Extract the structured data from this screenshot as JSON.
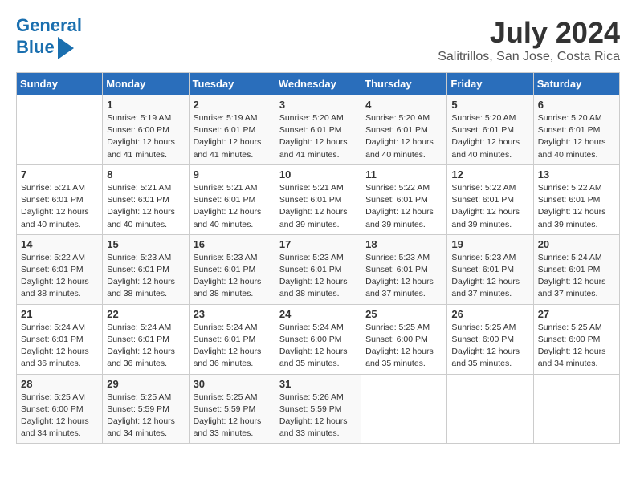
{
  "header": {
    "logo_line1": "General",
    "logo_line2": "Blue",
    "month_year": "July 2024",
    "location": "Salitrillos, San Jose, Costa Rica"
  },
  "days_of_week": [
    "Sunday",
    "Monday",
    "Tuesday",
    "Wednesday",
    "Thursday",
    "Friday",
    "Saturday"
  ],
  "weeks": [
    [
      {
        "day": "",
        "info": ""
      },
      {
        "day": "1",
        "info": "Sunrise: 5:19 AM\nSunset: 6:00 PM\nDaylight: 12 hours\nand 41 minutes."
      },
      {
        "day": "2",
        "info": "Sunrise: 5:19 AM\nSunset: 6:01 PM\nDaylight: 12 hours\nand 41 minutes."
      },
      {
        "day": "3",
        "info": "Sunrise: 5:20 AM\nSunset: 6:01 PM\nDaylight: 12 hours\nand 41 minutes."
      },
      {
        "day": "4",
        "info": "Sunrise: 5:20 AM\nSunset: 6:01 PM\nDaylight: 12 hours\nand 40 minutes."
      },
      {
        "day": "5",
        "info": "Sunrise: 5:20 AM\nSunset: 6:01 PM\nDaylight: 12 hours\nand 40 minutes."
      },
      {
        "day": "6",
        "info": "Sunrise: 5:20 AM\nSunset: 6:01 PM\nDaylight: 12 hours\nand 40 minutes."
      }
    ],
    [
      {
        "day": "7",
        "info": ""
      },
      {
        "day": "8",
        "info": "Sunrise: 5:21 AM\nSunset: 6:01 PM\nDaylight: 12 hours\nand 40 minutes."
      },
      {
        "day": "9",
        "info": "Sunrise: 5:21 AM\nSunset: 6:01 PM\nDaylight: 12 hours\nand 40 minutes."
      },
      {
        "day": "10",
        "info": "Sunrise: 5:21 AM\nSunset: 6:01 PM\nDaylight: 12 hours\nand 39 minutes."
      },
      {
        "day": "11",
        "info": "Sunrise: 5:22 AM\nSunset: 6:01 PM\nDaylight: 12 hours\nand 39 minutes."
      },
      {
        "day": "12",
        "info": "Sunrise: 5:22 AM\nSunset: 6:01 PM\nDaylight: 12 hours\nand 39 minutes."
      },
      {
        "day": "13",
        "info": "Sunrise: 5:22 AM\nSunset: 6:01 PM\nDaylight: 12 hours\nand 39 minutes."
      }
    ],
    [
      {
        "day": "14",
        "info": ""
      },
      {
        "day": "15",
        "info": "Sunrise: 5:23 AM\nSunset: 6:01 PM\nDaylight: 12 hours\nand 38 minutes."
      },
      {
        "day": "16",
        "info": "Sunrise: 5:23 AM\nSunset: 6:01 PM\nDaylight: 12 hours\nand 38 minutes."
      },
      {
        "day": "17",
        "info": "Sunrise: 5:23 AM\nSunset: 6:01 PM\nDaylight: 12 hours\nand 38 minutes."
      },
      {
        "day": "18",
        "info": "Sunrise: 5:23 AM\nSunset: 6:01 PM\nDaylight: 12 hours\nand 37 minutes."
      },
      {
        "day": "19",
        "info": "Sunrise: 5:23 AM\nSunset: 6:01 PM\nDaylight: 12 hours\nand 37 minutes."
      },
      {
        "day": "20",
        "info": "Sunrise: 5:24 AM\nSunset: 6:01 PM\nDaylight: 12 hours\nand 37 minutes."
      }
    ],
    [
      {
        "day": "21",
        "info": ""
      },
      {
        "day": "22",
        "info": "Sunrise: 5:24 AM\nSunset: 6:01 PM\nDaylight: 12 hours\nand 36 minutes."
      },
      {
        "day": "23",
        "info": "Sunrise: 5:24 AM\nSunset: 6:01 PM\nDaylight: 12 hours\nand 36 minutes."
      },
      {
        "day": "24",
        "info": "Sunrise: 5:24 AM\nSunset: 6:00 PM\nDaylight: 12 hours\nand 35 minutes."
      },
      {
        "day": "25",
        "info": "Sunrise: 5:25 AM\nSunset: 6:00 PM\nDaylight: 12 hours\nand 35 minutes."
      },
      {
        "day": "26",
        "info": "Sunrise: 5:25 AM\nSunset: 6:00 PM\nDaylight: 12 hours\nand 35 minutes."
      },
      {
        "day": "27",
        "info": "Sunrise: 5:25 AM\nSunset: 6:00 PM\nDaylight: 12 hours\nand 34 minutes."
      }
    ],
    [
      {
        "day": "28",
        "info": "Sunrise: 5:25 AM\nSunset: 6:00 PM\nDaylight: 12 hours\nand 34 minutes."
      },
      {
        "day": "29",
        "info": "Sunrise: 5:25 AM\nSunset: 5:59 PM\nDaylight: 12 hours\nand 34 minutes."
      },
      {
        "day": "30",
        "info": "Sunrise: 5:25 AM\nSunset: 5:59 PM\nDaylight: 12 hours\nand 33 minutes."
      },
      {
        "day": "31",
        "info": "Sunrise: 5:26 AM\nSunset: 5:59 PM\nDaylight: 12 hours\nand 33 minutes."
      },
      {
        "day": "",
        "info": ""
      },
      {
        "day": "",
        "info": ""
      },
      {
        "day": "",
        "info": ""
      }
    ]
  ],
  "week7_sunday": "Sunrise: 5:21 AM\nSunset: 6:01 PM\nDaylight: 12 hours\nand 40 minutes.",
  "week14_sunday": "Sunrise: 5:22 AM\nSunset: 6:01 PM\nDaylight: 12 hours\nand 38 minutes.",
  "week21_sunday": "Sunrise: 5:24 AM\nSunset: 6:01 PM\nDaylight: 12 hours\nand 36 minutes."
}
